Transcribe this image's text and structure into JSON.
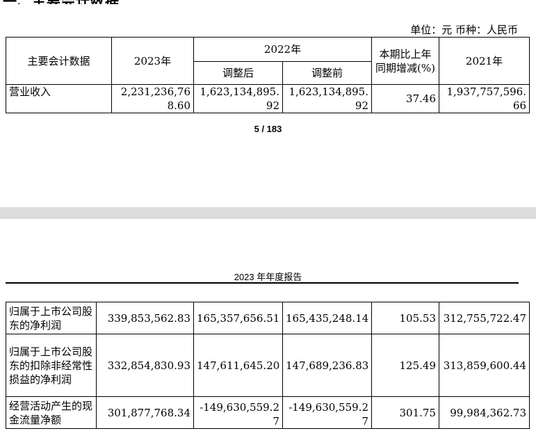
{
  "page1": {
    "unit_line": "单位：元  币种：人民币",
    "headers": {
      "item": "主要会计数据",
      "y2023": "2023年",
      "y2022": "2022年",
      "adjusted_after": "调整后",
      "adjusted_before": "调整前",
      "change": "本期比上年同期增减(%)",
      "y2021": "2021年"
    },
    "rows": [
      {
        "label": "营业收入",
        "v2023": "2,231,236,768.60",
        "after": "1,623,134,895.92",
        "before": "1,623,134,895.92",
        "change": "37.46",
        "v2021": "1,937,757,596.66"
      }
    ],
    "page_number": "5 / 183"
  },
  "page2": {
    "header_title": "2023 年年度报告",
    "rows": [
      {
        "label": "归属于上市公司股东的净利润",
        "v2023": "339,853,562.83",
        "after": "165,357,656.51",
        "before": "165,435,248.14",
        "change": "105.53",
        "v2021": "312,755,722.47"
      },
      {
        "label": "归属于上市公司股东的扣除非经常性损益的净利润",
        "v2023": "332,854,830.93",
        "after": "147,611,645.20",
        "before": "147,689,236.83",
        "change": "125.49",
        "v2021": "313,859,600.44"
      },
      {
        "label": "经营活动产生的现金流量净额",
        "v2023": "301,877,768.34",
        "after": "-149,630,559.27",
        "before": "-149,630,559.27",
        "change": "301.75",
        "v2021": "99,984,362.73"
      }
    ]
  }
}
